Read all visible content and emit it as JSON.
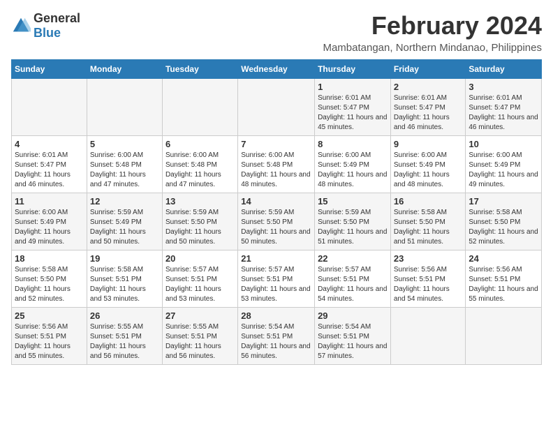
{
  "logo": {
    "general": "General",
    "blue": "Blue"
  },
  "title": "February 2024",
  "subtitle": "Mambatangan, Northern Mindanao, Philippines",
  "headers": [
    "Sunday",
    "Monday",
    "Tuesday",
    "Wednesday",
    "Thursday",
    "Friday",
    "Saturday"
  ],
  "weeks": [
    [
      {
        "day": "",
        "sunrise": "",
        "sunset": "",
        "daylight": ""
      },
      {
        "day": "",
        "sunrise": "",
        "sunset": "",
        "daylight": ""
      },
      {
        "day": "",
        "sunrise": "",
        "sunset": "",
        "daylight": ""
      },
      {
        "day": "",
        "sunrise": "",
        "sunset": "",
        "daylight": ""
      },
      {
        "day": "1",
        "sunrise": "Sunrise: 6:01 AM",
        "sunset": "Sunset: 5:47 PM",
        "daylight": "Daylight: 11 hours and 45 minutes."
      },
      {
        "day": "2",
        "sunrise": "Sunrise: 6:01 AM",
        "sunset": "Sunset: 5:47 PM",
        "daylight": "Daylight: 11 hours and 46 minutes."
      },
      {
        "day": "3",
        "sunrise": "Sunrise: 6:01 AM",
        "sunset": "Sunset: 5:47 PM",
        "daylight": "Daylight: 11 hours and 46 minutes."
      }
    ],
    [
      {
        "day": "4",
        "sunrise": "Sunrise: 6:01 AM",
        "sunset": "Sunset: 5:47 PM",
        "daylight": "Daylight: 11 hours and 46 minutes."
      },
      {
        "day": "5",
        "sunrise": "Sunrise: 6:00 AM",
        "sunset": "Sunset: 5:48 PM",
        "daylight": "Daylight: 11 hours and 47 minutes."
      },
      {
        "day": "6",
        "sunrise": "Sunrise: 6:00 AM",
        "sunset": "Sunset: 5:48 PM",
        "daylight": "Daylight: 11 hours and 47 minutes."
      },
      {
        "day": "7",
        "sunrise": "Sunrise: 6:00 AM",
        "sunset": "Sunset: 5:48 PM",
        "daylight": "Daylight: 11 hours and 48 minutes."
      },
      {
        "day": "8",
        "sunrise": "Sunrise: 6:00 AM",
        "sunset": "Sunset: 5:49 PM",
        "daylight": "Daylight: 11 hours and 48 minutes."
      },
      {
        "day": "9",
        "sunrise": "Sunrise: 6:00 AM",
        "sunset": "Sunset: 5:49 PM",
        "daylight": "Daylight: 11 hours and 48 minutes."
      },
      {
        "day": "10",
        "sunrise": "Sunrise: 6:00 AM",
        "sunset": "Sunset: 5:49 PM",
        "daylight": "Daylight: 11 hours and 49 minutes."
      }
    ],
    [
      {
        "day": "11",
        "sunrise": "Sunrise: 6:00 AM",
        "sunset": "Sunset: 5:49 PM",
        "daylight": "Daylight: 11 hours and 49 minutes."
      },
      {
        "day": "12",
        "sunrise": "Sunrise: 5:59 AM",
        "sunset": "Sunset: 5:49 PM",
        "daylight": "Daylight: 11 hours and 50 minutes."
      },
      {
        "day": "13",
        "sunrise": "Sunrise: 5:59 AM",
        "sunset": "Sunset: 5:50 PM",
        "daylight": "Daylight: 11 hours and 50 minutes."
      },
      {
        "day": "14",
        "sunrise": "Sunrise: 5:59 AM",
        "sunset": "Sunset: 5:50 PM",
        "daylight": "Daylight: 11 hours and 50 minutes."
      },
      {
        "day": "15",
        "sunrise": "Sunrise: 5:59 AM",
        "sunset": "Sunset: 5:50 PM",
        "daylight": "Daylight: 11 hours and 51 minutes."
      },
      {
        "day": "16",
        "sunrise": "Sunrise: 5:58 AM",
        "sunset": "Sunset: 5:50 PM",
        "daylight": "Daylight: 11 hours and 51 minutes."
      },
      {
        "day": "17",
        "sunrise": "Sunrise: 5:58 AM",
        "sunset": "Sunset: 5:50 PM",
        "daylight": "Daylight: 11 hours and 52 minutes."
      }
    ],
    [
      {
        "day": "18",
        "sunrise": "Sunrise: 5:58 AM",
        "sunset": "Sunset: 5:50 PM",
        "daylight": "Daylight: 11 hours and 52 minutes."
      },
      {
        "day": "19",
        "sunrise": "Sunrise: 5:58 AM",
        "sunset": "Sunset: 5:51 PM",
        "daylight": "Daylight: 11 hours and 53 minutes."
      },
      {
        "day": "20",
        "sunrise": "Sunrise: 5:57 AM",
        "sunset": "Sunset: 5:51 PM",
        "daylight": "Daylight: 11 hours and 53 minutes."
      },
      {
        "day": "21",
        "sunrise": "Sunrise: 5:57 AM",
        "sunset": "Sunset: 5:51 PM",
        "daylight": "Daylight: 11 hours and 53 minutes."
      },
      {
        "day": "22",
        "sunrise": "Sunrise: 5:57 AM",
        "sunset": "Sunset: 5:51 PM",
        "daylight": "Daylight: 11 hours and 54 minutes."
      },
      {
        "day": "23",
        "sunrise": "Sunrise: 5:56 AM",
        "sunset": "Sunset: 5:51 PM",
        "daylight": "Daylight: 11 hours and 54 minutes."
      },
      {
        "day": "24",
        "sunrise": "Sunrise: 5:56 AM",
        "sunset": "Sunset: 5:51 PM",
        "daylight": "Daylight: 11 hours and 55 minutes."
      }
    ],
    [
      {
        "day": "25",
        "sunrise": "Sunrise: 5:56 AM",
        "sunset": "Sunset: 5:51 PM",
        "daylight": "Daylight: 11 hours and 55 minutes."
      },
      {
        "day": "26",
        "sunrise": "Sunrise: 5:55 AM",
        "sunset": "Sunset: 5:51 PM",
        "daylight": "Daylight: 11 hours and 56 minutes."
      },
      {
        "day": "27",
        "sunrise": "Sunrise: 5:55 AM",
        "sunset": "Sunset: 5:51 PM",
        "daylight": "Daylight: 11 hours and 56 minutes."
      },
      {
        "day": "28",
        "sunrise": "Sunrise: 5:54 AM",
        "sunset": "Sunset: 5:51 PM",
        "daylight": "Daylight: 11 hours and 56 minutes."
      },
      {
        "day": "29",
        "sunrise": "Sunrise: 5:54 AM",
        "sunset": "Sunset: 5:51 PM",
        "daylight": "Daylight: 11 hours and 57 minutes."
      },
      {
        "day": "",
        "sunrise": "",
        "sunset": "",
        "daylight": ""
      },
      {
        "day": "",
        "sunrise": "",
        "sunset": "",
        "daylight": ""
      }
    ]
  ]
}
